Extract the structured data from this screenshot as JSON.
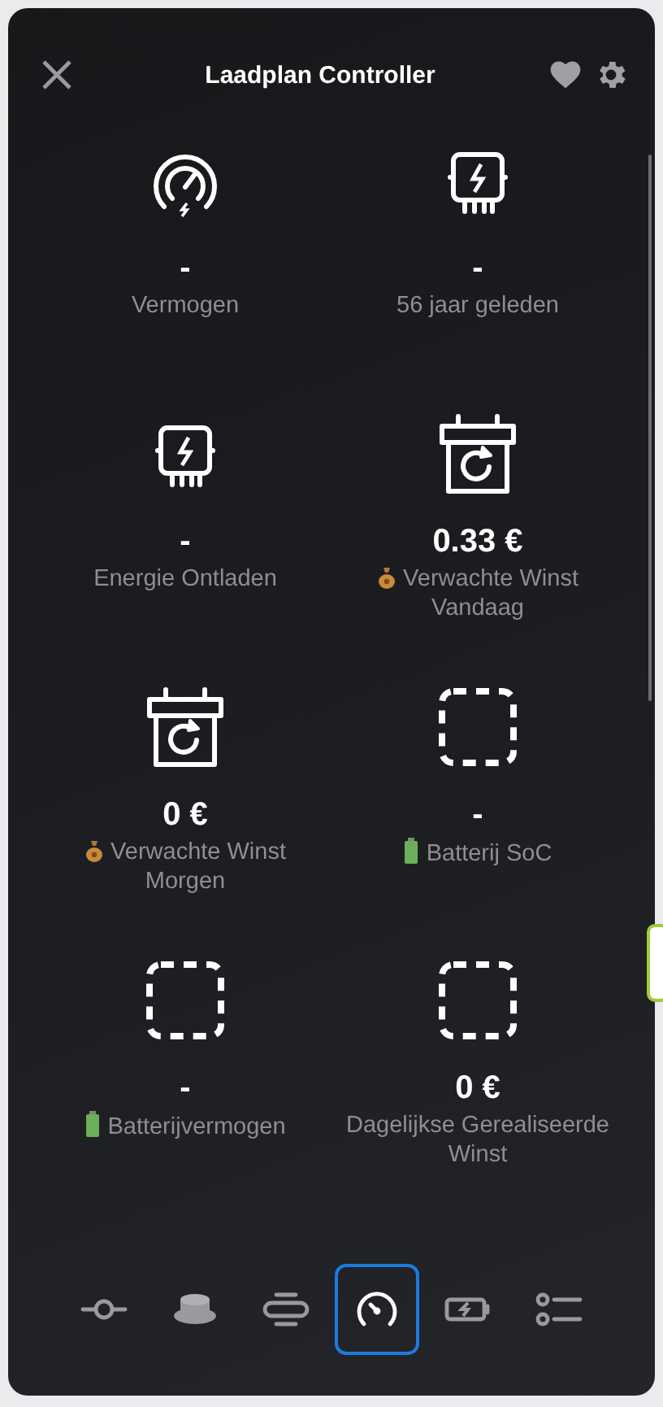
{
  "window": {
    "title": "Laadplan Controller"
  },
  "tiles": [
    {
      "kind": "gauge",
      "value": "-",
      "label": "Vermogen"
    },
    {
      "kind": "inverter",
      "value": "-",
      "label": "56 jaar geleden"
    },
    {
      "kind": "inverter",
      "value": "-",
      "label": "Energie Ontladen"
    },
    {
      "kind": "calendar",
      "value": "0.33 €",
      "label": "Verwachte Winst Vandaag",
      "label_badge": {
        "kind": "money"
      }
    },
    {
      "kind": "calendar",
      "value": "0 €",
      "label": "Verwachte Winst Morgen",
      "label_badge": {
        "kind": "money"
      }
    },
    {
      "kind": "empty",
      "value": "-",
      "label": "Batterij SoC",
      "label_badge": {
        "kind": "battery"
      }
    },
    {
      "kind": "empty",
      "value": "-",
      "label": "Batterijvermogen",
      "label_badge": {
        "kind": "battery"
      }
    },
    {
      "kind": "empty",
      "value": "0 €",
      "label": "Dagelijkse Gerealiseerde Winst"
    }
  ],
  "tabs": [
    {
      "kind": "slider",
      "selected": false
    },
    {
      "kind": "button",
      "selected": false
    },
    {
      "kind": "lines",
      "selected": false
    },
    {
      "kind": "gauge",
      "selected": true
    },
    {
      "kind": "battery",
      "selected": false
    },
    {
      "kind": "list",
      "selected": false
    }
  ]
}
